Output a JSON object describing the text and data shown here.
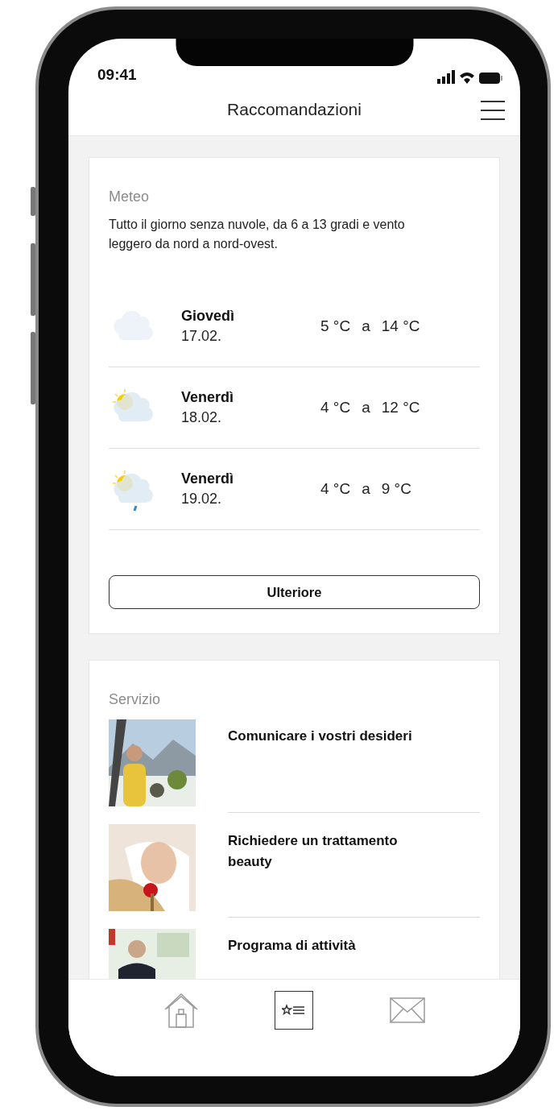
{
  "status_bar": {
    "time": "09:41"
  },
  "header": {
    "title": "Raccomandazioni"
  },
  "weather": {
    "heading": "Meteo",
    "summary": "Tutto il giorno senza nuvole, da 6 a 13 gradi e vento leggero da nord a nord-ovest.",
    "days": [
      {
        "kind": "cloud",
        "day": "Giovedì",
        "date": "17.02.",
        "low": "5 °C",
        "sep": "a",
        "high": "14 °C"
      },
      {
        "kind": "sun-cloud",
        "day": "Venerdì",
        "date": "18.02.",
        "low": "4 °C",
        "sep": "a",
        "high": "12 °C"
      },
      {
        "kind": "sun-rain",
        "day": "Venerdì",
        "date": "19.02.",
        "low": "4 °C",
        "sep": "a",
        "high": "9 °C"
      }
    ],
    "more_button": "Ulteriore"
  },
  "service": {
    "heading": "Servizio",
    "items": [
      {
        "title": "Comunicare i vostri desideri"
      },
      {
        "title": "Richiedere un trattamento beauty"
      },
      {
        "title": "Programa di attività"
      }
    ]
  },
  "tab_bar": [
    {
      "kind": "home",
      "selected": false
    },
    {
      "kind": "list",
      "selected": true
    },
    {
      "kind": "mail",
      "selected": false
    }
  ]
}
